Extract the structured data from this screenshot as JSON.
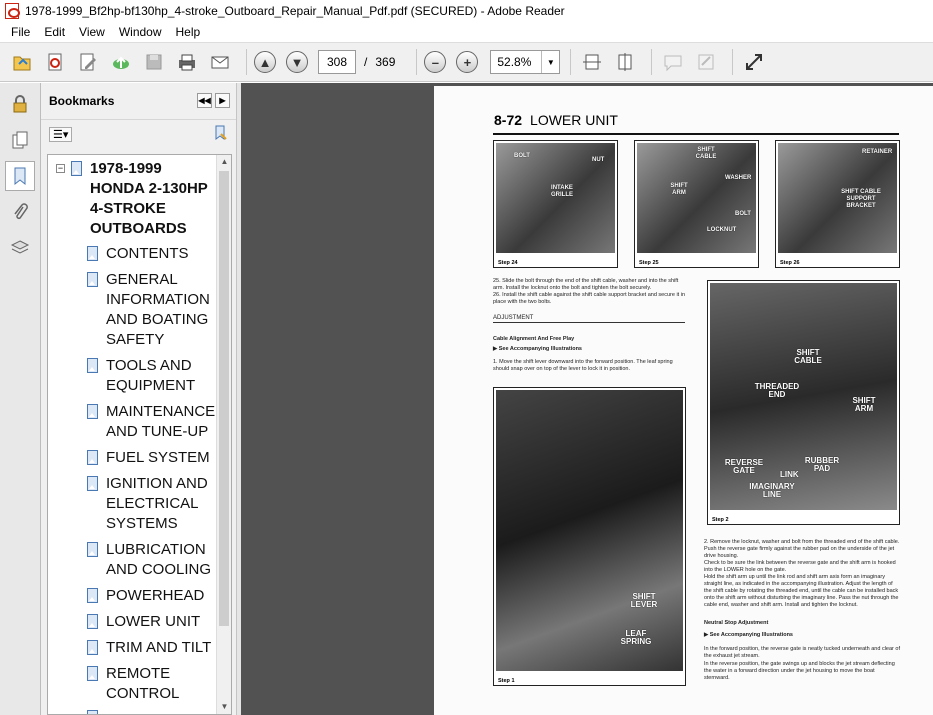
{
  "window": {
    "title": "1978-1999_Bf2hp-bf130hp_4-stroke_Outboard_Repair_Manual_Pdf.pdf (SECURED) - Adobe Reader"
  },
  "menu": [
    "File",
    "Edit",
    "View",
    "Window",
    "Help"
  ],
  "toolbar": {
    "page_current": "308",
    "page_separator": "/",
    "page_total": "369",
    "zoom": "52.8%",
    "zoom_out": "–",
    "zoom_in": "+"
  },
  "bookmarks": {
    "title": "Bookmarks",
    "root": "1978-1999 HONDA 2-130HP 4-STROKE OUTBOARDS",
    "items": [
      "CONTENTS",
      "GENERAL INFORMATION AND BOATING SAFETY",
      "TOOLS AND EQUIPMENT",
      "MAINTENANCE AND TUNE-UP",
      "FUEL SYSTEM",
      "IGNITION AND ELECTRICAL SYSTEMS",
      "LUBRICATION AND COOLING",
      "POWERHEAD",
      "LOWER UNIT",
      "TRIM AND TILT",
      "REMOTE CONTROL"
    ]
  },
  "doc": {
    "page_number": "8-72",
    "section": "LOWER UNIT",
    "step24": {
      "label": "Step 24",
      "callouts": [
        "BOLT",
        "NUT",
        "INTAKE GRILLE"
      ]
    },
    "step25": {
      "label": "Step 25",
      "callouts": [
        "SHIFT CABLE",
        "WASHER",
        "SHIFT ARM",
        "BOLT",
        "LOCKNUT"
      ]
    },
    "step26": {
      "label": "Step 26",
      "callouts": [
        "RETAINER",
        "SHIFT CABLE SUPPORT BRACKET"
      ]
    },
    "para25": "25. Slide the bolt through the end of the shift cable, washer and into the shift arm. Install the locknut onto the bolt and tighten the bolt securely.",
    "para26": "26. Install the shift cable against the shift cable support bracket and secure it in place with the two bolts.",
    "adjustment": "ADJUSTMENT",
    "cable_heading": "Cable Alignment And Free Play",
    "see1": "▶ See Accompanying Illustrations",
    "para1": "1. Move the shift lever downward into the forward position. The leaf spring should snap over on top of the lever to lock it in position.",
    "step1": {
      "label": "Step 1",
      "callouts": [
        "SHIFT LEVER",
        "LEAF SPRING"
      ]
    },
    "step2": {
      "label": "Step 2",
      "callouts": [
        "SHIFT CABLE",
        "THREADED END",
        "SHIFT ARM",
        "REVERSE GATE",
        "LINK",
        "RUBBER PAD",
        "IMAGINARY LINE"
      ]
    },
    "para2": "2. Remove the locknut, washer and bolt from the threaded end of the shift cable. Push the reverse gate firmly against the rubber pad on the underside of the jet drive housing.",
    "para2b": "Check to be sure the link between the reverse gate and the shift arm is hooked into the LOWER hole on the gate.",
    "para2c": "Hold the shift arm up until the link rod and shift arm axis form an imaginary straight line, as indicated in the accompanying illustration. Adjust the length of the shift cable by rotating the threaded end, until the cable can be installed back onto the shift arm without disturbing the imaginary line. Pass the nut through the cable end, washer and shift arm. Install and tighten the locknut.",
    "neutral_heading": "Neutral Stop Adjustment",
    "see2": "▶ See Accompanying Illustrations",
    "para3": "In the forward position, the reverse gate is neatly tucked underneath and clear of the exhaust jet stream.",
    "para4": "In the reverse position, the gate swings up and blocks the jet stream deflecting the water in a forward direction under the jet housing to move the boat sternward."
  }
}
